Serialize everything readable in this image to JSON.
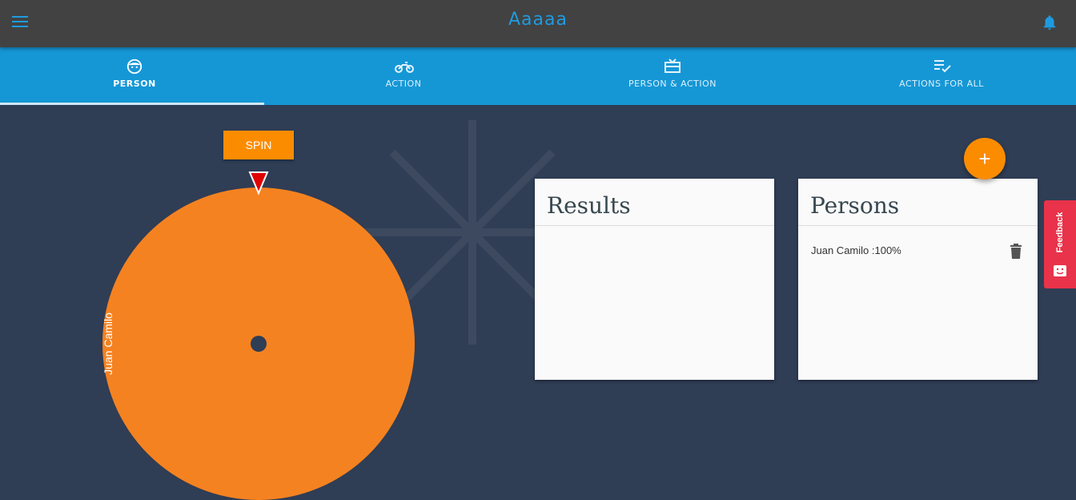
{
  "app": {
    "title": "Aaaaa",
    "menu_icon": "menu-icon",
    "bell_icon": "bell-icon",
    "accent": "#1e9be0"
  },
  "tabs": [
    {
      "label": "PERSON",
      "icon": "face-icon",
      "active": true
    },
    {
      "label": "ACTION",
      "icon": "motorbike-icon",
      "active": false
    },
    {
      "label": "PERSON & ACTION",
      "icon": "gift-card-icon",
      "active": false
    },
    {
      "label": "ACTIONS FOR ALL",
      "icon": "playlist-check-icon",
      "active": false
    }
  ],
  "spin": {
    "label": "SPIN"
  },
  "wheel": {
    "segments": [
      {
        "label": "Juan Camilo",
        "percent": 100,
        "color": "#f58220"
      }
    ],
    "pointer_color": "#e00000",
    "hub_color": "#2f3d55"
  },
  "results_card": {
    "title": "Results",
    "items": []
  },
  "persons_card": {
    "title": "Persons",
    "items": [
      {
        "label": "Juan Camilo :100%"
      }
    ]
  },
  "fab": {
    "label": "+",
    "color": "#fb8c00"
  },
  "feedback": {
    "label": "Feedback",
    "color": "#e8334a"
  }
}
